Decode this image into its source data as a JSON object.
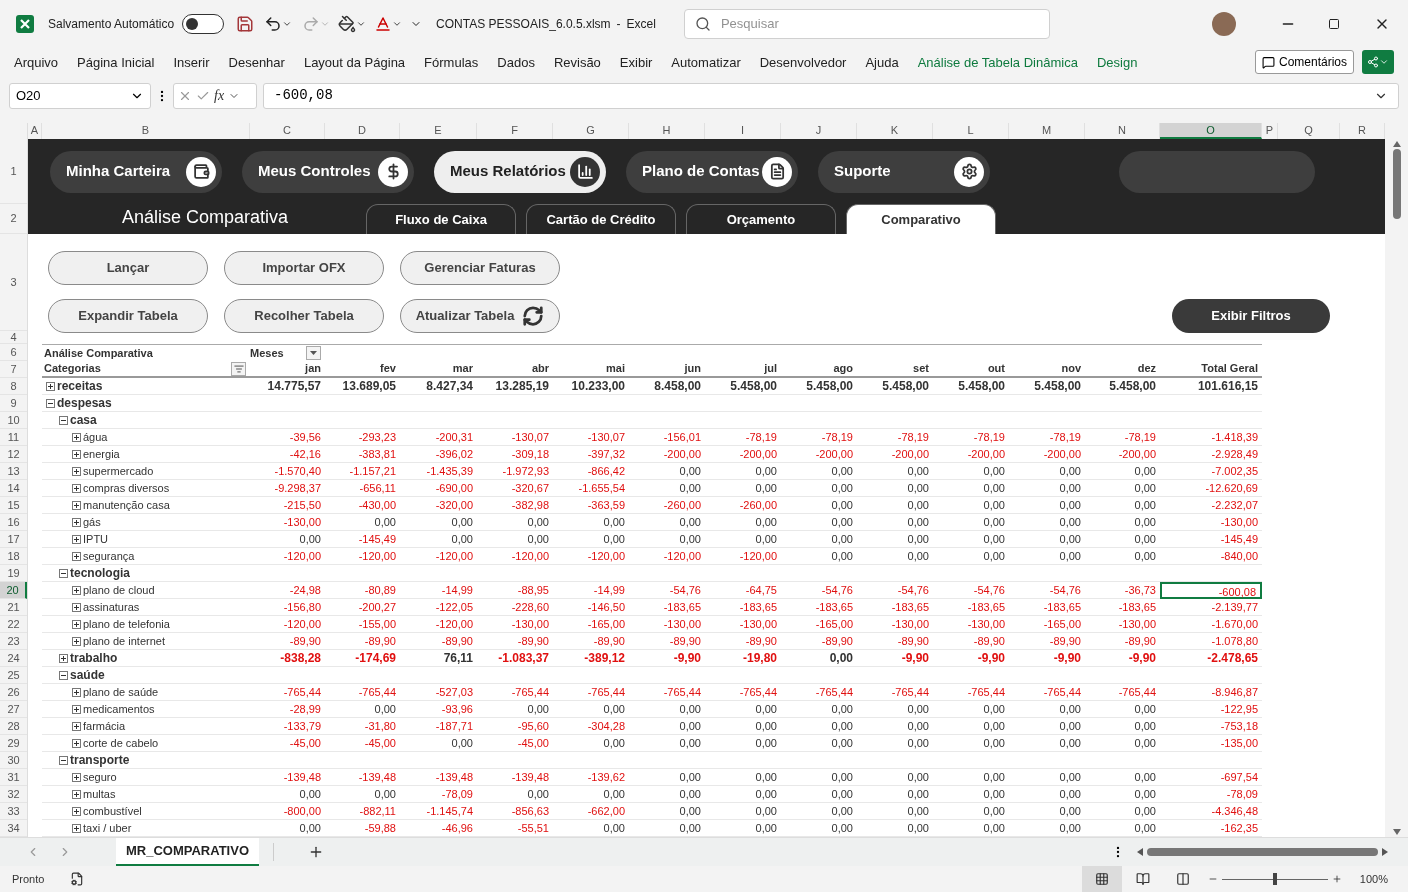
{
  "titlebar": {
    "autosave_label": "Salvamento Automático",
    "autosave_on": false,
    "filename": "CONTAS PESSOAIS_6.0.5.xlsm",
    "separator": "-",
    "app": "Excel",
    "search_placeholder": "Pesquisar"
  },
  "ribbon_tabs": [
    {
      "label": "Arquivo",
      "kind": "normal"
    },
    {
      "label": "Página Inicial",
      "kind": "normal"
    },
    {
      "label": "Inserir",
      "kind": "normal"
    },
    {
      "label": "Desenhar",
      "kind": "normal"
    },
    {
      "label": "Layout da Página",
      "kind": "normal"
    },
    {
      "label": "Fórmulas",
      "kind": "normal"
    },
    {
      "label": "Dados",
      "kind": "normal"
    },
    {
      "label": "Revisão",
      "kind": "normal"
    },
    {
      "label": "Exibir",
      "kind": "normal"
    },
    {
      "label": "Automatizar",
      "kind": "normal"
    },
    {
      "label": "Desenvolvedor",
      "kind": "normal"
    },
    {
      "label": "Ajuda",
      "kind": "normal"
    },
    {
      "label": "Análise de Tabela Dinâmica",
      "kind": "contextual"
    },
    {
      "label": "Design",
      "kind": "contextual"
    }
  ],
  "comments_button": "Comentários",
  "formula_bar": {
    "name_box": "O20",
    "function_label": "fx",
    "formula": "-600,08"
  },
  "columns": [
    {
      "label": "A",
      "selected": false
    },
    {
      "label": "B",
      "selected": false
    },
    {
      "label": "C",
      "selected": false
    },
    {
      "label": "D",
      "selected": false
    },
    {
      "label": "E",
      "selected": false
    },
    {
      "label": "F",
      "selected": false
    },
    {
      "label": "G",
      "selected": false
    },
    {
      "label": "H",
      "selected": false
    },
    {
      "label": "I",
      "selected": false
    },
    {
      "label": "J",
      "selected": false
    },
    {
      "label": "K",
      "selected": false
    },
    {
      "label": "L",
      "selected": false
    },
    {
      "label": "M",
      "selected": false
    },
    {
      "label": "N",
      "selected": false
    },
    {
      "label": "O",
      "selected": true
    },
    {
      "label": "P",
      "selected": false
    },
    {
      "label": "Q",
      "selected": false
    },
    {
      "label": "R",
      "selected": false
    }
  ],
  "row_headers": [
    {
      "label": "1",
      "selected": false
    },
    {
      "label": "2",
      "selected": false
    },
    {
      "label": "3",
      "selected": false
    },
    {
      "label": "4",
      "selected": false
    },
    {
      "label": "6",
      "selected": false
    },
    {
      "label": "7",
      "selected": false
    },
    {
      "label": "8",
      "selected": false
    },
    {
      "label": "9",
      "selected": false
    },
    {
      "label": "10",
      "selected": false
    },
    {
      "label": "11",
      "selected": false
    },
    {
      "label": "12",
      "selected": false
    },
    {
      "label": "13",
      "selected": false
    },
    {
      "label": "14",
      "selected": false
    },
    {
      "label": "15",
      "selected": false
    },
    {
      "label": "16",
      "selected": false
    },
    {
      "label": "17",
      "selected": false
    },
    {
      "label": "18",
      "selected": false
    },
    {
      "label": "19",
      "selected": false
    },
    {
      "label": "20",
      "selected": true
    },
    {
      "label": "21",
      "selected": false
    },
    {
      "label": "22",
      "selected": false
    },
    {
      "label": "23",
      "selected": false
    },
    {
      "label": "24",
      "selected": false
    },
    {
      "label": "25",
      "selected": false
    },
    {
      "label": "26",
      "selected": false
    },
    {
      "label": "27",
      "selected": false
    },
    {
      "label": "28",
      "selected": false
    },
    {
      "label": "29",
      "selected": false
    },
    {
      "label": "30",
      "selected": false
    },
    {
      "label": "31",
      "selected": false
    },
    {
      "label": "32",
      "selected": false
    },
    {
      "label": "33",
      "selected": false
    },
    {
      "label": "34",
      "selected": false
    }
  ],
  "nav_buttons": [
    {
      "label": "Minha Carteira",
      "kind": "wallet",
      "selected": false
    },
    {
      "label": "Meus Controles",
      "kind": "dollar",
      "selected": false
    },
    {
      "label": "Meus Relatórios",
      "kind": "chart",
      "selected": true
    },
    {
      "label": "Plano de Contas",
      "kind": "list",
      "selected": false
    },
    {
      "label": "Suporte",
      "kind": "gear",
      "selected": false
    }
  ],
  "page_title": "Análise Comparativa",
  "report_tabs": [
    {
      "label": "Fluxo de Caixa",
      "selected": false
    },
    {
      "label": "Cartão de Crédito",
      "selected": false
    },
    {
      "label": "Orçamento",
      "selected": false
    },
    {
      "label": "Comparativo",
      "selected": true
    }
  ],
  "action_buttons": [
    [
      {
        "label": "Lançar",
        "kind": "plain"
      },
      {
        "label": "Importar OFX",
        "kind": "plain"
      },
      {
        "label": "Gerenciar Faturas",
        "kind": "plain"
      }
    ],
    [
      {
        "label": "Expandir Tabela",
        "kind": "plain"
      },
      {
        "label": "Recolher Tabela",
        "kind": "plain"
      },
      {
        "label": "Atualizar Tabela",
        "kind": "refresh"
      }
    ]
  ],
  "filter_button": "Exibir Filtros",
  "pivot": {
    "title": "Análise Comparativa",
    "column_field": "Meses",
    "row_field": "Categorias",
    "months": [
      "jan",
      "fev",
      "mar",
      "abr",
      "mai",
      "jun",
      "jul",
      "ago",
      "set",
      "out",
      "nov",
      "dez"
    ],
    "total_label": "Total Geral",
    "rows": [
      {
        "label": "receitas",
        "expanded": false,
        "selected": false,
        "values": [
          "14.775,57",
          "13.689,05",
          "8.427,34",
          "13.285,19",
          "10.233,00",
          "8.458,00",
          "5.458,00",
          "5.458,00",
          "5.458,00",
          "5.458,00",
          "5.458,00",
          "5.458,00",
          "101.616,15"
        ]
      },
      {
        "label": "despesas",
        "expanded": true,
        "children": [
          {
            "label": "casa",
            "expanded": true,
            "children": [
              {
                "label": "água",
                "expanded": false,
                "selected": false,
                "values": [
                  "-39,56",
                  "-293,23",
                  "-200,31",
                  "-130,07",
                  "-130,07",
                  "-156,01",
                  "-78,19",
                  "-78,19",
                  "-78,19",
                  "-78,19",
                  "-78,19",
                  "-78,19",
                  "-1.418,39"
                ]
              },
              {
                "label": "energia",
                "expanded": false,
                "selected": false,
                "values": [
                  "-42,16",
                  "-383,81",
                  "-396,02",
                  "-309,18",
                  "-397,32",
                  "-200,00",
                  "-200,00",
                  "-200,00",
                  "-200,00",
                  "-200,00",
                  "-200,00",
                  "-200,00",
                  "-2.928,49"
                ]
              },
              {
                "label": "supermercado",
                "expanded": false,
                "selected": false,
                "values": [
                  "-1.570,40",
                  "-1.157,21",
                  "-1.435,39",
                  "-1.972,93",
                  "-866,42",
                  "0,00",
                  "0,00",
                  "0,00",
                  "0,00",
                  "0,00",
                  "0,00",
                  "0,00",
                  "-7.002,35"
                ]
              },
              {
                "label": "compras diversos",
                "expanded": false,
                "selected": false,
                "values": [
                  "-9.298,37",
                  "-656,11",
                  "-690,00",
                  "-320,67",
                  "-1.655,54",
                  "0,00",
                  "0,00",
                  "0,00",
                  "0,00",
                  "0,00",
                  "0,00",
                  "0,00",
                  "-12.620,69"
                ]
              },
              {
                "label": "manutenção casa",
                "expanded": false,
                "selected": false,
                "values": [
                  "-215,50",
                  "-430,00",
                  "-320,00",
                  "-382,98",
                  "-363,59",
                  "-260,00",
                  "-260,00",
                  "0,00",
                  "0,00",
                  "0,00",
                  "0,00",
                  "0,00",
                  "-2.232,07"
                ]
              },
              {
                "label": "gás",
                "expanded": false,
                "selected": false,
                "values": [
                  "-130,00",
                  "0,00",
                  "0,00",
                  "0,00",
                  "0,00",
                  "0,00",
                  "0,00",
                  "0,00",
                  "0,00",
                  "0,00",
                  "0,00",
                  "0,00",
                  "-130,00"
                ]
              },
              {
                "label": "IPTU",
                "expanded": false,
                "selected": false,
                "values": [
                  "0,00",
                  "-145,49",
                  "0,00",
                  "0,00",
                  "0,00",
                  "0,00",
                  "0,00",
                  "0,00",
                  "0,00",
                  "0,00",
                  "0,00",
                  "0,00",
                  "-145,49"
                ]
              },
              {
                "label": "segurança",
                "expanded": false,
                "selected": false,
                "values": [
                  "-120,00",
                  "-120,00",
                  "-120,00",
                  "-120,00",
                  "-120,00",
                  "-120,00",
                  "-120,00",
                  "0,00",
                  "0,00",
                  "0,00",
                  "0,00",
                  "0,00",
                  "-840,00"
                ]
              }
            ]
          },
          {
            "label": "tecnologia",
            "expanded": true,
            "children": [
              {
                "label": "plano de cloud",
                "expanded": false,
                "selected": true,
                "values": [
                  "-24,98",
                  "-80,89",
                  "-14,99",
                  "-88,95",
                  "-14,99",
                  "-54,76",
                  "-64,75",
                  "-54,76",
                  "-54,76",
                  "-54,76",
                  "-54,76",
                  "-36,73",
                  "-600,08"
                ]
              },
              {
                "label": "assinaturas",
                "expanded": false,
                "selected": false,
                "values": [
                  "-156,80",
                  "-200,27",
                  "-122,05",
                  "-228,60",
                  "-146,50",
                  "-183,65",
                  "-183,65",
                  "-183,65",
                  "-183,65",
                  "-183,65",
                  "-183,65",
                  "-183,65",
                  "-2.139,77"
                ]
              },
              {
                "label": "plano de telefonia",
                "expanded": false,
                "selected": false,
                "values": [
                  "-120,00",
                  "-155,00",
                  "-120,00",
                  "-130,00",
                  "-165,00",
                  "-130,00",
                  "-130,00",
                  "-165,00",
                  "-130,00",
                  "-130,00",
                  "-165,00",
                  "-130,00",
                  "-1.670,00"
                ]
              },
              {
                "label": "plano de internet",
                "expanded": false,
                "selected": false,
                "values": [
                  "-89,90",
                  "-89,90",
                  "-89,90",
                  "-89,90",
                  "-89,90",
                  "-89,90",
                  "-89,90",
                  "-89,90",
                  "-89,90",
                  "-89,90",
                  "-89,90",
                  "-89,90",
                  "-1.078,80"
                ]
              }
            ]
          },
          {
            "label": "trabalho",
            "expanded": false,
            "selected": false,
            "values": [
              "-838,28",
              "-174,69",
              "76,11",
              "-1.083,37",
              "-389,12",
              "-9,90",
              "-19,80",
              "0,00",
              "-9,90",
              "-9,90",
              "-9,90",
              "-9,90",
              "-2.478,65"
            ]
          },
          {
            "label": "saúde",
            "expanded": true,
            "children": [
              {
                "label": "plano de saúde",
                "expanded": false,
                "selected": false,
                "values": [
                  "-765,44",
                  "-765,44",
                  "-527,03",
                  "-765,44",
                  "-765,44",
                  "-765,44",
                  "-765,44",
                  "-765,44",
                  "-765,44",
                  "-765,44",
                  "-765,44",
                  "-765,44",
                  "-8.946,87"
                ]
              },
              {
                "label": "medicamentos",
                "expanded": false,
                "selected": false,
                "values": [
                  "-28,99",
                  "0,00",
                  "-93,96",
                  "0,00",
                  "0,00",
                  "0,00",
                  "0,00",
                  "0,00",
                  "0,00",
                  "0,00",
                  "0,00",
                  "0,00",
                  "-122,95"
                ]
              },
              {
                "label": "farmácia",
                "expanded": false,
                "selected": false,
                "values": [
                  "-133,79",
                  "-31,80",
                  "-187,71",
                  "-95,60",
                  "-304,28",
                  "0,00",
                  "0,00",
                  "0,00",
                  "0,00",
                  "0,00",
                  "0,00",
                  "0,00",
                  "-753,18"
                ]
              },
              {
                "label": "corte de cabelo",
                "expanded": false,
                "selected": false,
                "values": [
                  "-45,00",
                  "-45,00",
                  "0,00",
                  "-45,00",
                  "0,00",
                  "0,00",
                  "0,00",
                  "0,00",
                  "0,00",
                  "0,00",
                  "0,00",
                  "0,00",
                  "-135,00"
                ]
              }
            ]
          },
          {
            "label": "transporte",
            "expanded": true,
            "children": [
              {
                "label": "seguro",
                "expanded": false,
                "selected": false,
                "values": [
                  "-139,48",
                  "-139,48",
                  "-139,48",
                  "-139,48",
                  "-139,62",
                  "0,00",
                  "0,00",
                  "0,00",
                  "0,00",
                  "0,00",
                  "0,00",
                  "0,00",
                  "-697,54"
                ]
              },
              {
                "label": "multas",
                "expanded": false,
                "selected": false,
                "values": [
                  "0,00",
                  "0,00",
                  "-78,09",
                  "0,00",
                  "0,00",
                  "0,00",
                  "0,00",
                  "0,00",
                  "0,00",
                  "0,00",
                  "0,00",
                  "0,00",
                  "-78,09"
                ]
              },
              {
                "label": "combustível",
                "expanded": false,
                "selected": false,
                "values": [
                  "-800,00",
                  "-882,11",
                  "-1.145,74",
                  "-856,63",
                  "-662,00",
                  "0,00",
                  "0,00",
                  "0,00",
                  "0,00",
                  "0,00",
                  "0,00",
                  "0,00",
                  "-4.346,48"
                ]
              },
              {
                "label": "taxi / uber",
                "expanded": false,
                "selected": false,
                "values": [
                  "0,00",
                  "-59,88",
                  "-46,96",
                  "-55,51",
                  "0,00",
                  "0,00",
                  "0,00",
                  "0,00",
                  "0,00",
                  "0,00",
                  "0,00",
                  "0,00",
                  "-162,35"
                ]
              }
            ]
          }
        ]
      }
    ]
  },
  "sheet_tabs": [
    {
      "label": "MR_COMPARATIVO",
      "selected": true
    }
  ],
  "status": {
    "text": "Pronto",
    "zoom_label": "100%",
    "zoom": {
      "level": 0.5
    }
  }
}
